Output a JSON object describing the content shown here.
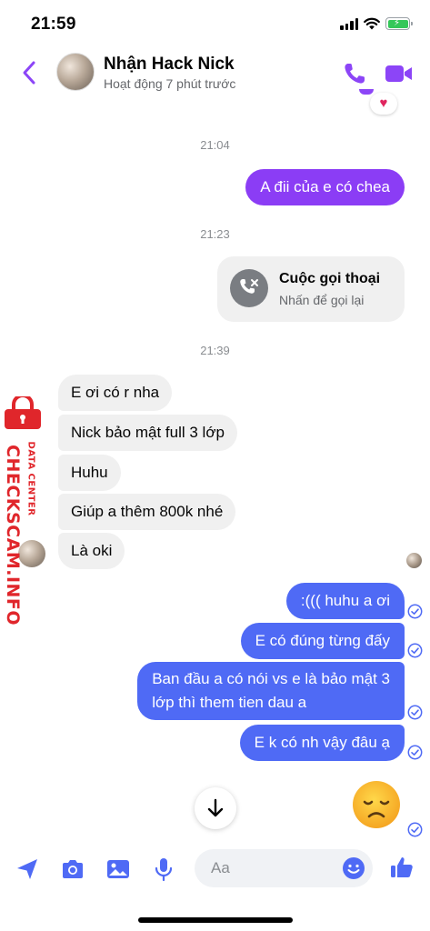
{
  "status_bar": {
    "time": "21:59"
  },
  "header": {
    "name": "Nhận Hack Nick",
    "status": "Hoạt động 7 phút trước"
  },
  "reaction": "heart",
  "timestamps": [
    "21:04",
    "21:23",
    "21:39"
  ],
  "messages_out_early": [
    "A đii của e có chea"
  ],
  "call_card": {
    "title": "Cuộc gọi thoại",
    "subtitle": "Nhấn để gọi lại"
  },
  "messages_in": [
    "E ơi có r nha",
    "Nick bảo mật full 3 lớp",
    "Huhu",
    "Giúp a thêm 800k nhé",
    "Là oki"
  ],
  "messages_out_late": [
    ":((( huhu a ơi",
    "E có đúng từng đấy",
    [
      "Ban đầu a có nói vs e là bảo mật 3",
      "lớp thì them tien dau a"
    ],
    "E k có nh vậy đâu ạ"
  ],
  "watermark": {
    "title": "CHECKSCAM.INFO",
    "subtitle": "DATA CENTER"
  },
  "composer": {
    "placeholder": "Aa"
  },
  "colors": {
    "accent": "#8c45f7",
    "bubble_out_early": "#8b3df5",
    "bubble_out_late": "#4f6af5",
    "bubble_in": "#f0f0f0",
    "watermark": "#e0262b"
  }
}
